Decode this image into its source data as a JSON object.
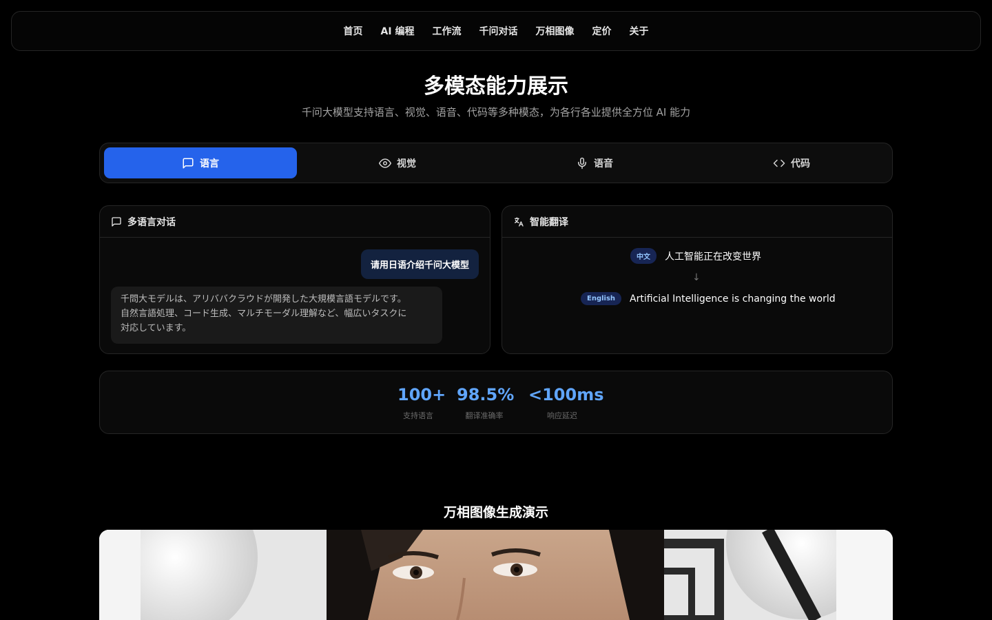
{
  "nav": {
    "items": [
      "首页",
      "AI 编程",
      "工作流",
      "千问对话",
      "万相图像",
      "定价",
      "关于"
    ]
  },
  "hero": {
    "title": "多模态能力展示",
    "subtitle": "千问大模型支持语言、视觉、语音、代码等多种模态，为各行各业提供全方位 AI 能力"
  },
  "tabs": [
    {
      "label": "语言",
      "icon": "message-square-icon",
      "active": true
    },
    {
      "label": "视觉",
      "icon": "eye-icon",
      "active": false
    },
    {
      "label": "语音",
      "icon": "mic-icon",
      "active": false
    },
    {
      "label": "代码",
      "icon": "code-icon",
      "active": false
    }
  ],
  "chat_card": {
    "title": "多语言对话",
    "user_message": "请用日语介绍千问大模型",
    "bot_reply_lines": [
      "千問大モデルは、アリババクラウドが開発した大規模言語モデルです。",
      "自然言語処理、コード生成、マルチモーダル理解など、幅広いタスクに",
      "対応しています。"
    ]
  },
  "translate_card": {
    "title": "智能翻译",
    "source_lang": "中文",
    "source_text": "人工智能正在改变世界",
    "arrow": "↓",
    "target_lang": "English",
    "target_text": "Artificial Intelligence is changing the world"
  },
  "stats": [
    {
      "value": "100+",
      "label": "支持语言"
    },
    {
      "value": "98.5%",
      "label": "翻译准确率"
    },
    {
      "value": "<100ms",
      "label": "响应延迟"
    }
  ],
  "image_section": {
    "title": "万相图像生成演示"
  },
  "colors": {
    "accent": "#2563eb",
    "stat_value": "#60a5fa",
    "background": "#000000"
  }
}
